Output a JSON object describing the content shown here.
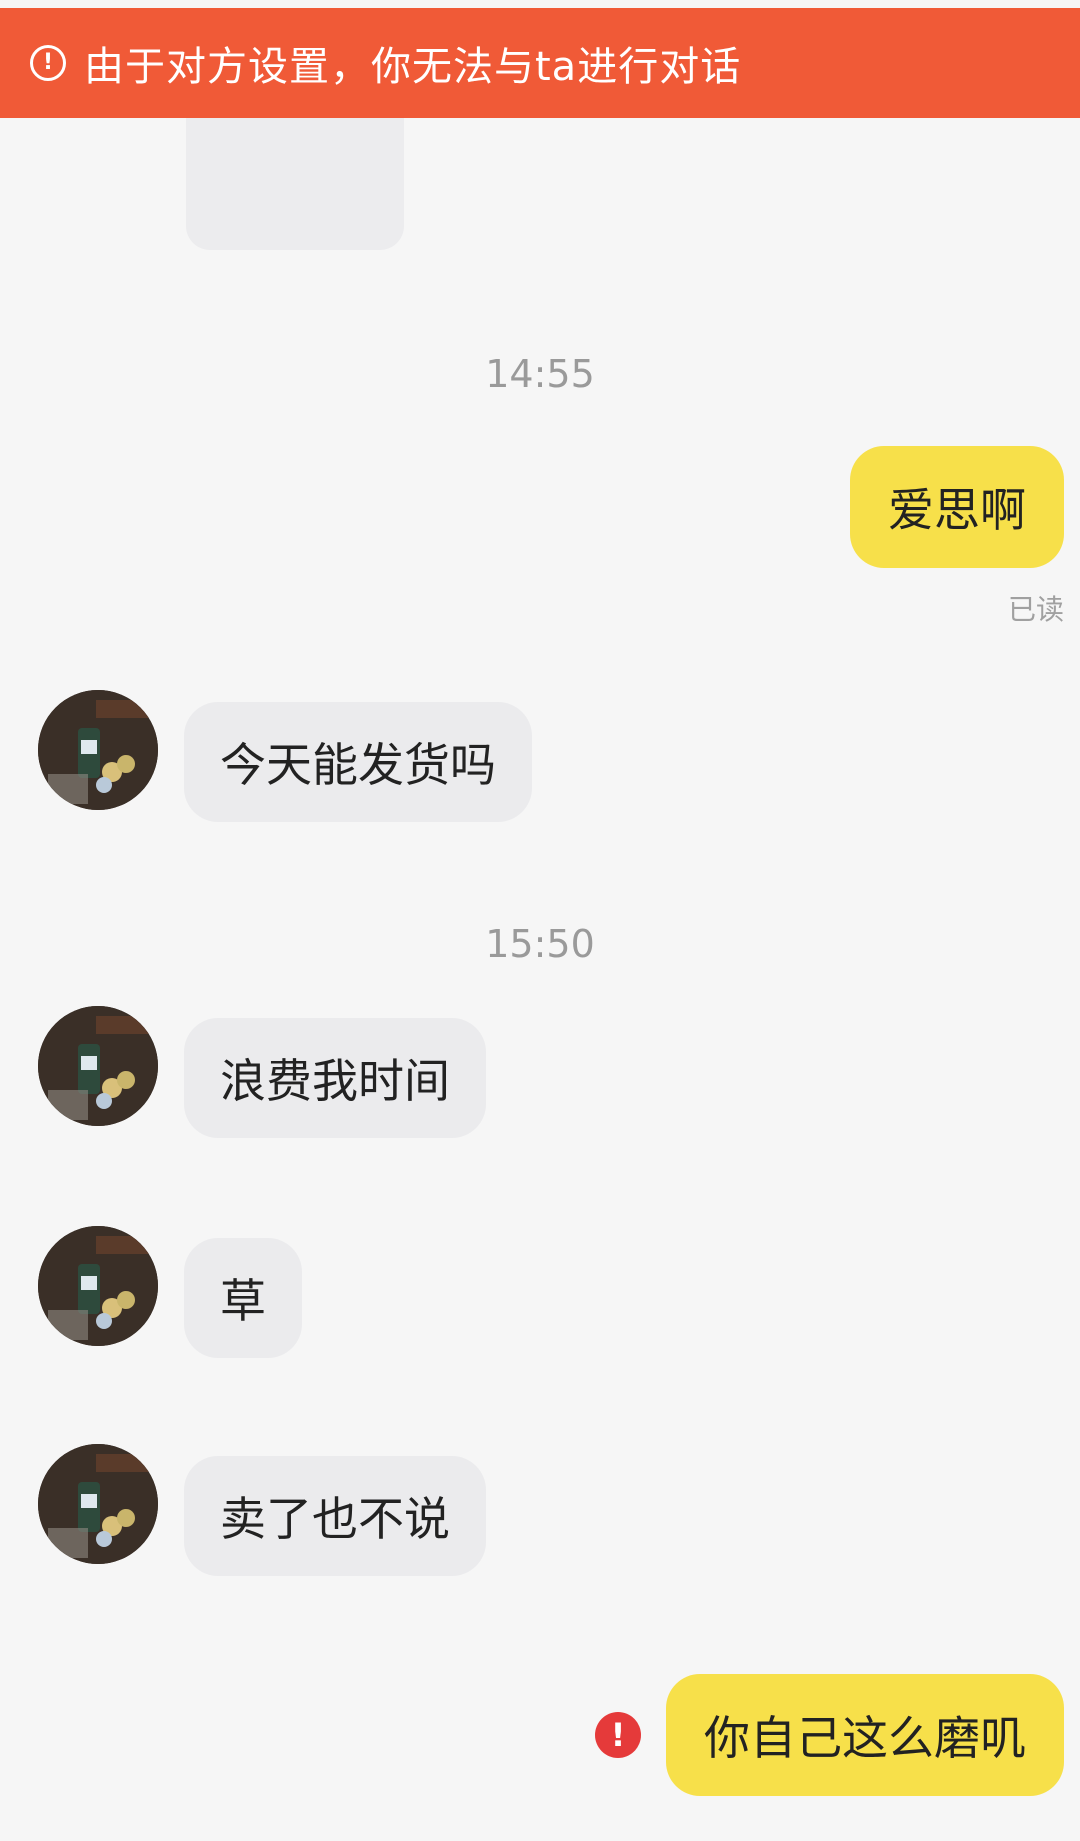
{
  "banner": {
    "icon": "alert-circle-icon",
    "text": "由于对方设置，你无法与ta进行对话"
  },
  "timestamps": [
    "14:55",
    "15:50"
  ],
  "messages": [
    {
      "direction": "out",
      "text": "爱思啊",
      "status": "已读"
    },
    {
      "direction": "in",
      "text": "今天能发货吗"
    },
    {
      "direction": "in",
      "text": "浪费我时间"
    },
    {
      "direction": "in",
      "text": "草"
    },
    {
      "direction": "in",
      "text": "卖了也不说"
    },
    {
      "direction": "out",
      "text": "你自己这么磨叽",
      "failed": true
    }
  ],
  "colors": {
    "banner": "#f05a37",
    "outgoing_bubble": "#f7e04a",
    "incoming_bubble": "#ebebed",
    "error": "#e53a3a"
  }
}
